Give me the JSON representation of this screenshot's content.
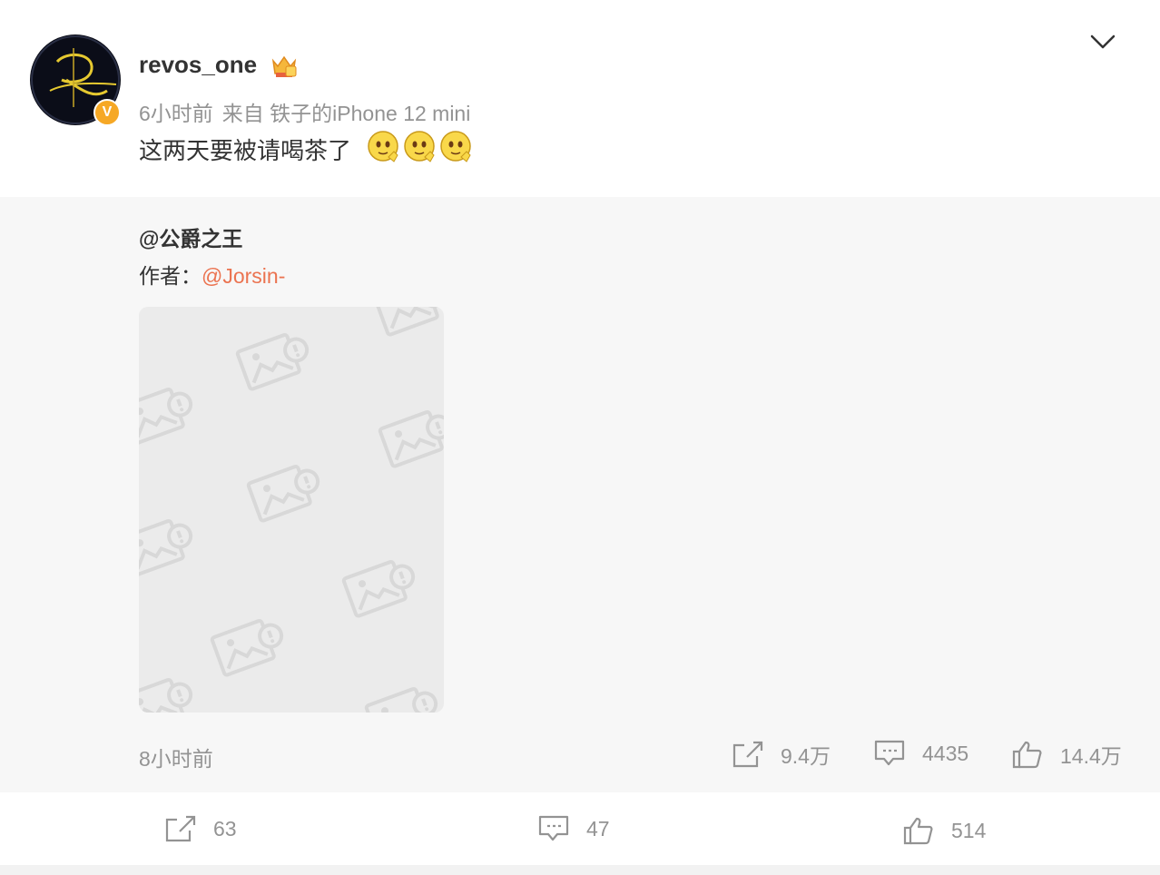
{
  "post": {
    "username": "revos_one",
    "time": "6小时前",
    "source": "来自 铁子的iPhone 12 mini",
    "text": "这两天要被请喝茶了",
    "emojis": [
      "emoji-1",
      "emoji-2",
      "emoji-3"
    ],
    "verified_mark": "V"
  },
  "repost": {
    "user": "@公爵之王",
    "author_label": "作者：",
    "author_link": "@Jorsin-",
    "time": "8小时前",
    "actions": {
      "share_count": "9.4万",
      "comment_count": "4435",
      "like_count": "14.4万"
    }
  },
  "bottom_actions": {
    "share_count": "63",
    "comment_count": "47",
    "like_count": "514"
  },
  "colors": {
    "link": "#eb7350",
    "muted": "#939393",
    "repost_bg": "#f7f7f7",
    "badge": "#f6a825"
  }
}
